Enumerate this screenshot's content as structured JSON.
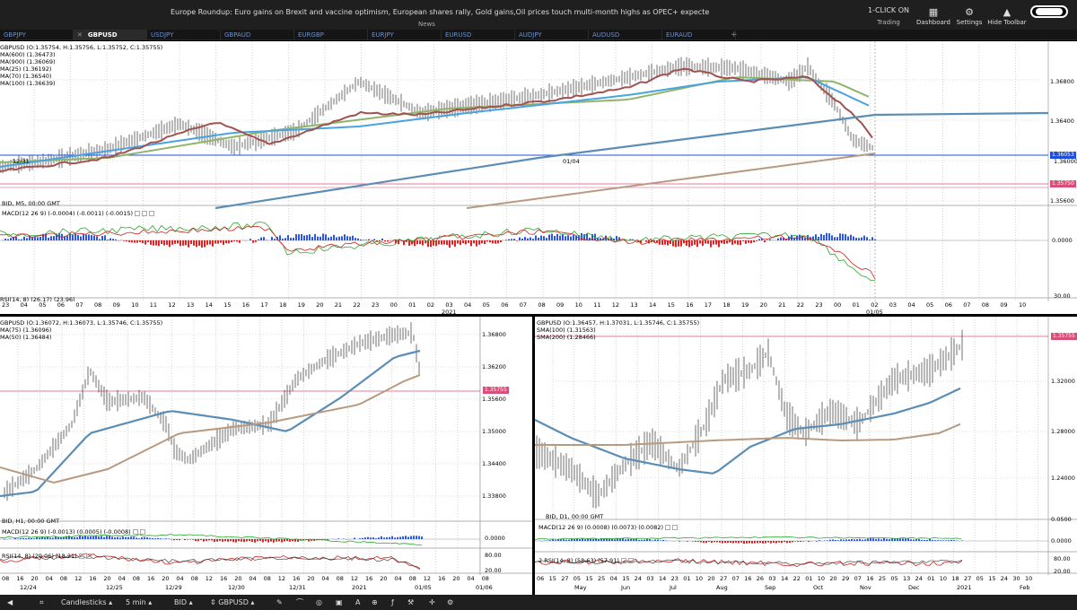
{
  "news": {
    "ticker": "Europe Roundup: Euro gains  on Brexit and vaccine optimism, European shares rally, Gold gains,Oil prices touch multi-month highs as OPEC+ expected to cap output-Janu:",
    "label": "News"
  },
  "topbar": {
    "one_click": "1-CLICK ON",
    "trading": "Trading",
    "dashboard": "Dashboard",
    "settings": "Settings",
    "hide_toolbar": "Hide Toolbar"
  },
  "tabs": [
    "GBPJPY",
    "GBPUSD",
    "USDJPY",
    "GBPAUD",
    "EURGBP",
    "EURJPY",
    "EURUSD",
    "AUDJPY",
    "AUDUSD",
    "EURAUD"
  ],
  "tab_add": "+",
  "main_chart": {
    "ohlc": "GBPUSD (O:1.35754, H:1.35756, L:1.35752, C:1.35755)",
    "ma": [
      "MA(600) (1.36473)",
      "MA(900) (1.36069)",
      "MA(25) (1.36192)",
      "MA(70) (1.36540)",
      "MA(100) (1.36639)"
    ],
    "bid_label": "BID, M5, 00:00 GMT",
    "yticks": [
      "1.36800",
      "1.36400",
      "1.36000",
      "1.35600"
    ],
    "tag_blue": "1.36053",
    "tag_red": "1.35750",
    "date_mid": "01/04",
    "date_left": "12/31",
    "macd_label": "MACD(12 26 9) (-0.0004) (-0.0011) (-0.0015)",
    "macd_zero": "0.0000",
    "rsi_label": "RSI(14, 8) (26.17) (23.96)",
    "rsi_tick": "30.00",
    "xticks": [
      "23",
      "04",
      "05",
      "06",
      "07",
      "08",
      "09",
      "10",
      "11",
      "12",
      "13",
      "14",
      "15",
      "16",
      "17",
      "18",
      "19",
      "20",
      "21",
      "22",
      "23",
      "00",
      "01",
      "02",
      "03",
      "04",
      "05",
      "06",
      "07",
      "08",
      "09",
      "10",
      "11",
      "12",
      "13",
      "14",
      "15",
      "16",
      "17",
      "18",
      "19",
      "20",
      "21",
      "22",
      "23",
      "00",
      "01",
      "02",
      "03",
      "04",
      "05",
      "06",
      "07",
      "08",
      "09",
      "10"
    ],
    "xdate_2021": "2021",
    "xdate_0105": "01/05"
  },
  "h1_chart": {
    "ohlc": "GBPUSD (O:1.36072, H:1.36073, L:1.35746, C:1.35755)",
    "ma": [
      "MA(75) (1.36096)",
      "MA(50) (1.36484)"
    ],
    "bid_label": "BID, H1, 00:00 GMT",
    "yticks": [
      "1.36800",
      "1.36200",
      "1.35600",
      "1.35000",
      "1.34400",
      "1.33800"
    ],
    "tag_red": "1.35755",
    "macd_label": "MACD(12 26 9) (-0.0013) (0.0005) (-0.0008)",
    "macd_zero": "0.0000",
    "rsi_label": "RSI(14, 8) (29.06) (18.21)",
    "rsi_ticks": [
      "80.00",
      "20.00"
    ],
    "xticks": [
      "08",
      "16",
      "20",
      "04",
      "08",
      "12",
      "16",
      "20",
      "04",
      "08",
      "16",
      "20",
      "04",
      "08",
      "12",
      "16",
      "20",
      "04",
      "08",
      "12",
      "16",
      "20",
      "04",
      "08",
      "12",
      "16",
      "20",
      "04",
      "08",
      "12",
      "16",
      "20",
      "04",
      "08"
    ],
    "xdates": [
      "12/24",
      "12/25",
      "12/29",
      "12/30",
      "12/31",
      "2021",
      "01/05",
      "01/06"
    ]
  },
  "d1_chart": {
    "ohlc": "GBPUSD (O:1.36457, H:1.37031, L:1.35746, C:1.35755)",
    "ma": [
      "SMA(100) (1.31563)",
      "SMA(200) (1.28466)"
    ],
    "bid_label": "BID, D1, 00:00 GMT",
    "yticks": [
      "1.32000",
      "1.28000",
      "1.24000"
    ],
    "tag_red": "1.35755",
    "macd_label": "MACD(12 26 9) (0.0008) (0.0073) (0.0082)",
    "macd_ticks": [
      "0.0500",
      "0.0000"
    ],
    "rsi_label": "2 RSI(14, 8) (58.63) (57.91)",
    "rsi_ticks": [
      "80.00",
      "20.00"
    ],
    "xticks": [
      "06",
      "15",
      "27",
      "05",
      "15",
      "25",
      "04",
      "15",
      "24",
      "03",
      "14",
      "23",
      "01",
      "10",
      "20",
      "27",
      "07",
      "16",
      "26",
      "03",
      "14",
      "22",
      "01",
      "10",
      "20",
      "29",
      "07",
      "16",
      "25",
      "05",
      "13",
      "24",
      "01",
      "10",
      "18",
      "27",
      "05",
      "15",
      "24",
      "30",
      "10"
    ],
    "xmonths": [
      "May",
      "Jun",
      "Jul",
      "Aug",
      "Sep",
      "Oct",
      "Nov",
      "Dec",
      "2021",
      "Feb"
    ]
  },
  "bottombar": {
    "chart_type": "Candlesticks",
    "timeframe": "5 min",
    "price_side": "BID",
    "symbol": "GBPUSD"
  },
  "colors": {
    "ma_blue": "#4aa3e0",
    "ma_red": "#a0524f",
    "ma_green": "#8fb46a",
    "ma_steel": "#5b8db5",
    "ma_tan": "#b89a80",
    "level_blue": "#1f4fd8",
    "level_red": "#d8507a",
    "macd_up": "#2a57e8",
    "macd_down": "#e52020"
  }
}
